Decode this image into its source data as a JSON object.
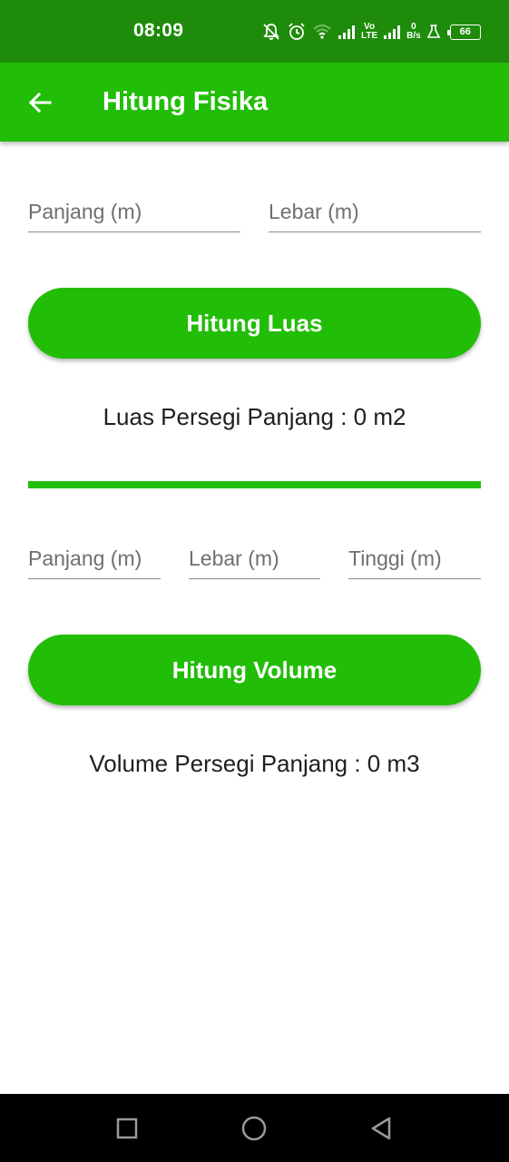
{
  "status_bar": {
    "time": "08:09",
    "volte_top": "Vo",
    "volte_bottom": "LTE",
    "speed_value": "0",
    "speed_unit": "B/s",
    "battery": "66",
    "icons": [
      "bell-off-icon",
      "alarm-icon",
      "wifi-icon",
      "signal-icon",
      "volte-icon",
      "signal-icon",
      "network-speed",
      "flask-icon",
      "battery-icon"
    ]
  },
  "app_bar": {
    "title": "Hitung Fisika",
    "back_icon": "arrow-left-icon"
  },
  "area_section": {
    "length_placeholder": "Panjang (m)",
    "width_placeholder": "Lebar (m)",
    "button_label": "Hitung Luas",
    "result_text": "Luas Persegi Panjang : 0 m2"
  },
  "volume_section": {
    "length_placeholder": "Panjang (m)",
    "width_placeholder": "Lebar (m)",
    "height_placeholder": "Tinggi (m)",
    "button_label": "Hitung Volume",
    "result_text": "Volume Persegi Panjang : 0 m3"
  },
  "nav_bar": {
    "icons": [
      "recents-square-icon",
      "home-circle-icon",
      "back-triangle-icon"
    ]
  },
  "colors": {
    "status_bar": "#1e8c0a",
    "primary": "#22bd07",
    "nav_bar": "#000000"
  }
}
